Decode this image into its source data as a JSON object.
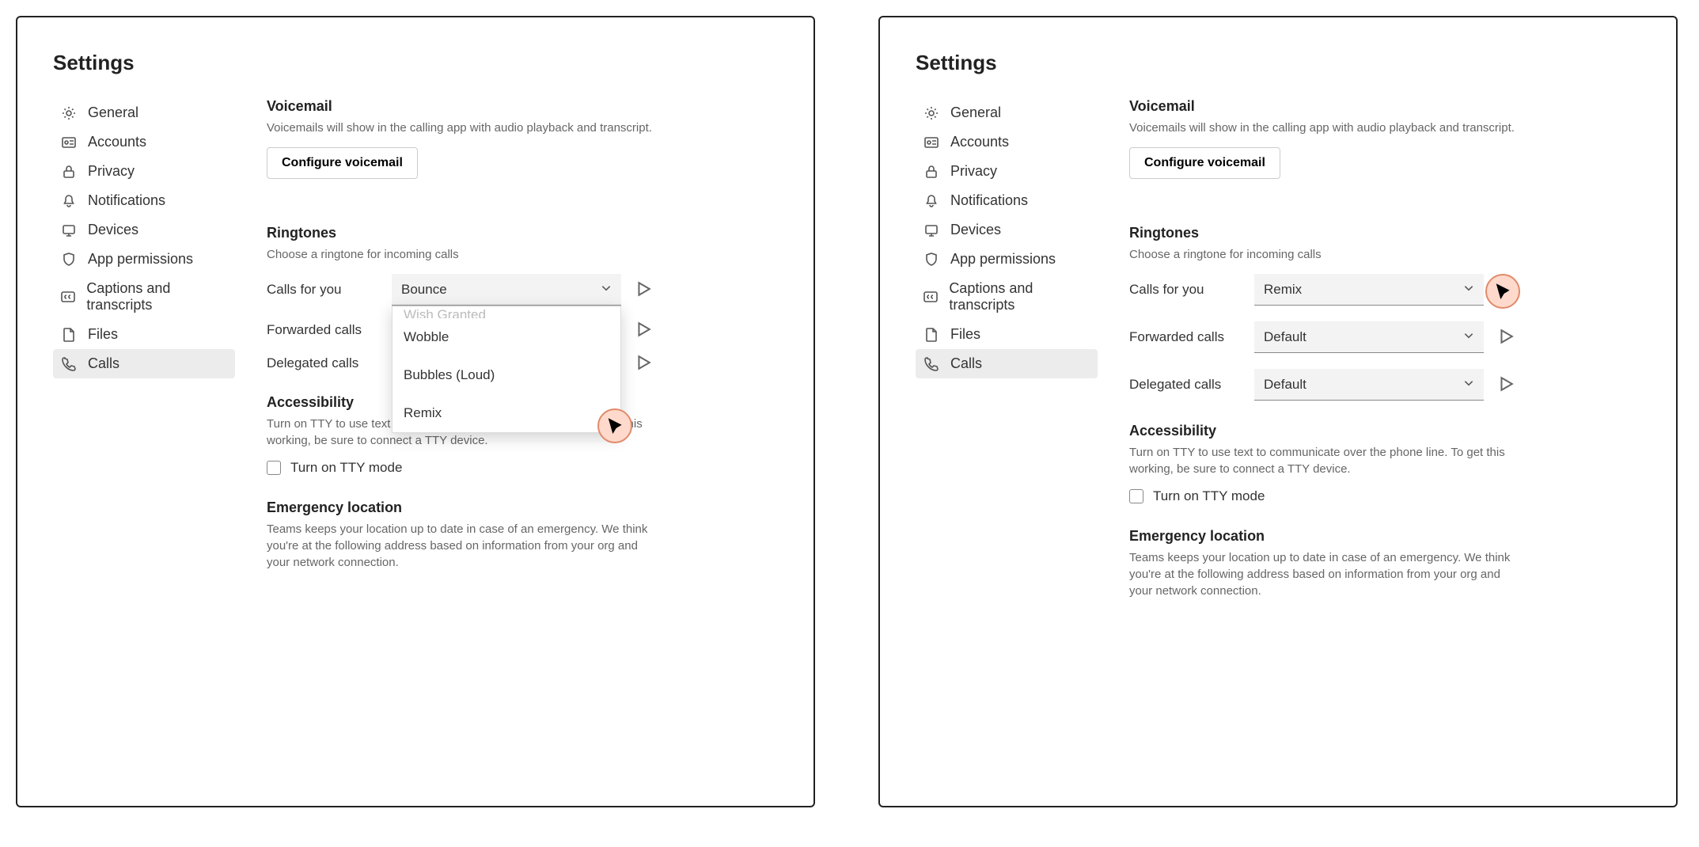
{
  "title": "Settings",
  "nav": {
    "general": "General",
    "accounts": "Accounts",
    "privacy": "Privacy",
    "notifications": "Notifications",
    "devices": "Devices",
    "app_permissions": "App permissions",
    "captions": "Captions and transcripts",
    "files": "Files",
    "calls": "Calls"
  },
  "voicemail": {
    "heading": "Voicemail",
    "desc": "Voicemails will show in the calling app with audio playback and transcript.",
    "button": "Configure voicemail"
  },
  "ringtones": {
    "heading": "Ringtones",
    "desc": "Choose a ringtone for incoming calls",
    "rows": {
      "calls_for_you": "Calls for you",
      "forwarded": "Forwarded calls",
      "delegated": "Delegated calls"
    },
    "left": {
      "calls_for_you_value": "Bounce",
      "forwarded_value": "",
      "delegated_value": ""
    },
    "right": {
      "calls_for_you_value": "Remix",
      "forwarded_value": "Default",
      "delegated_value": "Default"
    },
    "dropdown_options": {
      "cut": "Wish Granted",
      "o1": "Wobble",
      "o2": "Bubbles (Loud)",
      "o3": "Remix"
    }
  },
  "accessibility": {
    "heading": "Accessibility",
    "desc": "Turn on TTY to use text to communicate over the phone line. To get this working, be sure to connect a TTY device.",
    "checkbox_label": "Turn on TTY mode"
  },
  "emergency": {
    "heading": "Emergency location",
    "desc": "Teams keeps your location up to date in case of an emergency. We think you're at the following address based on information from your org and your network connection."
  }
}
